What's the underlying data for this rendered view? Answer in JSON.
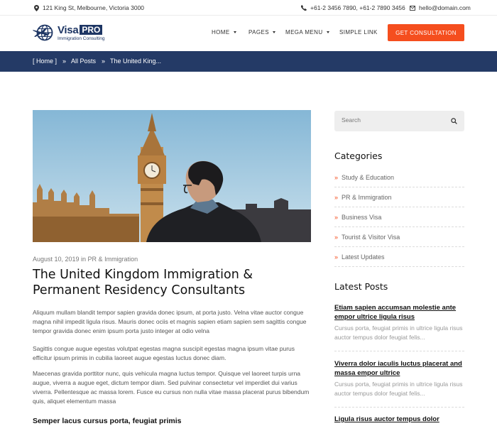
{
  "topbar": {
    "address": "121 King St, Melbourne, Victoria 3000",
    "phone": "+61-2 3456 7890,  +61-2 7890 3456",
    "email": "hello@domain.com"
  },
  "logo": {
    "word": "Visa",
    "badge": "PRO",
    "tagline": "Immigration Consulting"
  },
  "nav": {
    "items": [
      {
        "label": "HOME"
      },
      {
        "label": "PAGES"
      },
      {
        "label": "MEGA MENU"
      },
      {
        "label": "SIMPLE LINK"
      }
    ],
    "cta": "GET CONSULTATION"
  },
  "breadcrumb": {
    "home": "[ Home ]",
    "sep": "»",
    "posts": "All Posts",
    "current": "The United King..."
  },
  "post": {
    "meta": "August 10, 2019 in PR & Immigration",
    "title": "The United Kingdom Immigration & Permanent Residency Consultants",
    "paragraphs": [
      "Aliquum mullam blandit tempor sapien gravida donec ipsum, at porta justo. Velna vitae auctor congue magna nihil impedit ligula risus. Mauris donec ociis et magnis sapien etiam sapien sem sagittis congue tempor gravida donec enim ipsum porta justo integer at odio velna",
      "Sagittis congue augue egestas volutpat egestas magna suscipit egestas magna ipsum vitae purus efficitur ipsum primis in cubilia laoreet augue egestas luctus donec diam.",
      "Maecenas gravida porttitor nunc, quis vehicula magna luctus tempor. Quisque vel laoreet turpis urna augue, viverra a augue eget, dictum tempor diam. Sed pulvinar consectetur vel imperdiet dui varius viverra. Pellentesque ac massa lorem. Fusce eu cursus non nulla vitae massa placerat purus bibendum quis, aliquet elementum massa"
    ],
    "subheading": "Semper lacus cursus porta, feugiat primis"
  },
  "sidebar": {
    "search_placeholder": "Search",
    "categories_title": "Categories",
    "categories": [
      "Study & Education",
      "PR & Immigration",
      "Business Visa",
      "Tourist & Visitor Visa",
      "Latest Updates"
    ],
    "latest_title": "Latest Posts",
    "latest": [
      {
        "title": "Etiam sapien accumsan molestie ante empor ultrice ligula risus",
        "excerpt": "Cursus porta, feugiat primis in ultrice ligula risus auctor tempus dolor feugiat felis..."
      },
      {
        "title": "Viverra dolor iaculis luctus placerat and massa empor ultrice",
        "excerpt": "Cursus porta, feugiat primis in ultrice ligula risus auctor tempus dolor feugiat felis..."
      },
      {
        "title": "Ligula risus auctor tempus dolor",
        "excerpt": ""
      }
    ]
  },
  "colors": {
    "accent": "#f54e1e",
    "navy": "#243a66",
    "brand": "#1e3664"
  }
}
